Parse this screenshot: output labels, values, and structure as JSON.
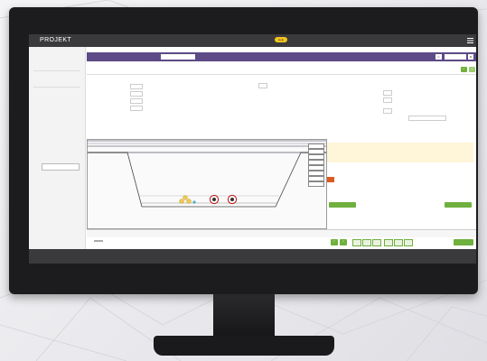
{
  "app": {
    "logo": "PROJEKT",
    "header_badge": "Help",
    "user_name": "",
    "brand_color": "#5d4a86",
    "accent_color": "#6fb03e"
  },
  "sidebar": {
    "items": [
      {
        "label": ""
      },
      {
        "label": ""
      },
      {
        "label": ""
      },
      {
        "label": ""
      },
      {
        "label": ""
      },
      {
        "label": ""
      },
      {
        "label": ""
      },
      {
        "label": ""
      }
    ],
    "button_label": ""
  },
  "project_bar": {
    "title": "",
    "select_value": "",
    "button_label": ""
  },
  "section": {
    "title": ""
  },
  "form": {
    "left_labels": [
      "",
      "",
      "",
      ""
    ],
    "mid_labels": [
      "",
      "",
      "",
      "",
      "",
      "",
      "",
      ""
    ],
    "right_labels": [
      "",
      "",
      "",
      "",
      ""
    ]
  },
  "actions": {
    "left_button": "",
    "right_button": ""
  },
  "tabs": [
    "",
    "",
    "",
    "",
    "",
    "",
    "",
    "",
    "",
    "",
    ""
  ],
  "bottom": {
    "tab_a": "",
    "tab_b": "",
    "title": "",
    "next_label": ""
  },
  "icons": {
    "menu": "hamburger-icon",
    "print": "print-icon",
    "check": "check-icon",
    "add": "plus-icon"
  }
}
